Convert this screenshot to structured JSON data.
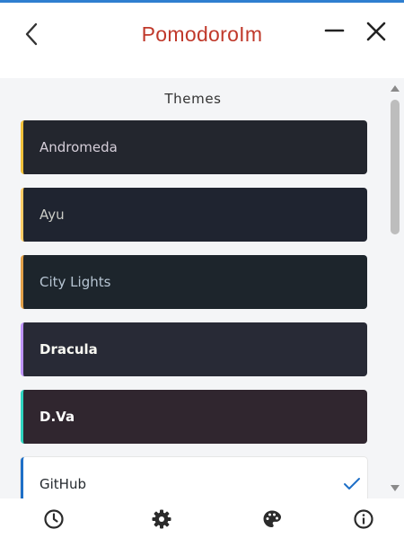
{
  "app": {
    "title": "PomodoroIm"
  },
  "colors": {
    "accent": "#c0392b",
    "check": "#1e6fc7",
    "top_accent": "#2f7fd0"
  },
  "section": {
    "title": "Themes"
  },
  "themes": [
    {
      "name": "Andromeda",
      "bg": "#23262e",
      "text": "#d5ced9",
      "stripe": "#f0c03a",
      "selected": false
    },
    {
      "name": "Ayu",
      "bg": "#1f2430",
      "text": "#cbccc6",
      "stripe": "#ffcc66",
      "selected": false
    },
    {
      "name": "City Lights",
      "bg": "#1d252c",
      "text": "#b7c5d3",
      "stripe": "#e2a14a",
      "selected": false
    },
    {
      "name": "Dracula",
      "bg": "#282a36",
      "text": "#f8f8f2",
      "stripe": "#bd93f9",
      "selected": false
    },
    {
      "name": "D.Va",
      "bg": "#30262f",
      "text": "#ffffff",
      "stripe": "#2fd4bf",
      "selected": false
    },
    {
      "name": "GitHub",
      "bg": "#ffffff",
      "text": "#24292e",
      "stripe": "#1e6fc7",
      "selected": true
    }
  ],
  "icons": {
    "back": "back-arrow-icon",
    "minimize": "minimize-icon",
    "close": "close-icon",
    "check": "check-icon",
    "timer": "clock-icon",
    "settings": "gear-icon",
    "themes": "palette-icon",
    "about": "info-icon"
  }
}
